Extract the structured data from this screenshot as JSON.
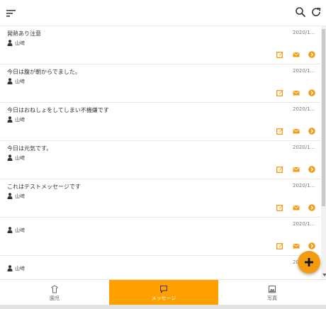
{
  "colors": {
    "accent": "#f39c12",
    "active_tab": "#ff9f00",
    "text": "#333333"
  },
  "header": {
    "menu_icon": "sort-icon",
    "search_icon": "search-icon",
    "refresh_icon": "refresh-icon"
  },
  "messages": [
    {
      "title": "発熱あり注意",
      "date": "2020/1...",
      "author": "山﨑"
    },
    {
      "title": "今日は腹が朝からでました。",
      "date": "2020/1...",
      "author": "山﨑"
    },
    {
      "title": "今日はおねしょをしてしまい不機嫌です",
      "date": "2020/1...",
      "author": "山﨑"
    },
    {
      "title": "今日は元気です。",
      "date": "2020/1...",
      "author": "山﨑"
    },
    {
      "title": "これはテストメッセージです",
      "date": "2020/1...",
      "author": "山﨑"
    },
    {
      "title": "",
      "date": "2020/1...",
      "author": "山﨑"
    },
    {
      "title": "",
      "date": "20",
      "author": "山﨑"
    }
  ],
  "fab": {
    "icon": "plus-icon"
  },
  "bottom_nav": [
    {
      "label": "園児",
      "icon": "child-icon"
    },
    {
      "label": "メッセージ",
      "icon": "chat-icon",
      "active": true
    },
    {
      "label": "写真",
      "icon": "photo-icon"
    }
  ]
}
